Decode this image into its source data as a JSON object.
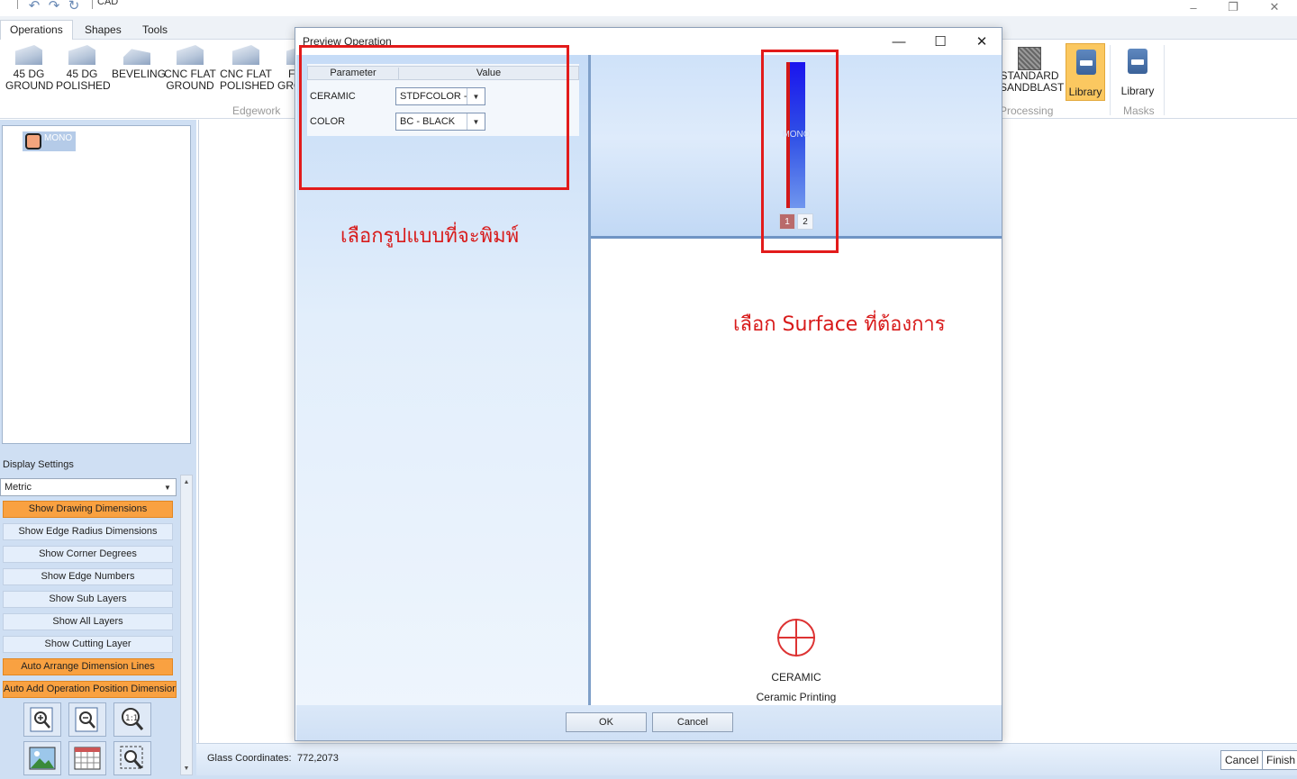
{
  "app": {
    "title": "CAD",
    "window_controls": {
      "minimize": "–",
      "restore": "❐",
      "close": "✕"
    }
  },
  "ribbon": {
    "tabs": [
      "Operations",
      "Shapes",
      "Tools"
    ],
    "edgework": {
      "group_label": "Edgework",
      "items": [
        {
          "line1": "45 DG",
          "line2": "GROUND"
        },
        {
          "line1": "45 DG",
          "line2": "POLISHED"
        },
        {
          "line1": "BEVELING",
          "line2": ""
        },
        {
          "line1": "CNC FLAT",
          "line2": "GROUND"
        },
        {
          "line1": "CNC FLAT",
          "line2": "POLISHED"
        },
        {
          "line1": "FL",
          "line2": "GRO"
        }
      ]
    },
    "processing": {
      "group_label": "Processing",
      "item": {
        "line1": "STANDARD",
        "line2": "SANDBLAST"
      },
      "library_label": "Library"
    },
    "masks": {
      "group_label": "Masks",
      "library_label": "Library"
    }
  },
  "tree": {
    "node_label": "MONO"
  },
  "display_settings": {
    "title": "Display Settings",
    "units": "Metric",
    "buttons": [
      {
        "label": "Show Drawing Dimensions",
        "active": true
      },
      {
        "label": "Show Edge Radius Dimensions",
        "active": false
      },
      {
        "label": "Show Corner Degrees",
        "active": false
      },
      {
        "label": "Show Edge Numbers",
        "active": false
      },
      {
        "label": "Show Sub Layers",
        "active": false
      },
      {
        "label": "Show All Layers",
        "active": false
      },
      {
        "label": "Show Cutting Layer",
        "active": false
      },
      {
        "label": "Auto Arrange Dimension Lines",
        "active": true
      },
      {
        "label": "Auto Add Operation Position Dimension",
        "active": true
      }
    ],
    "tools": [
      "zoom-in-icon",
      "zoom-out-icon",
      "zoom-1to1-icon",
      "image-icon",
      "grid-icon",
      "zoom-selection-icon"
    ]
  },
  "status": {
    "coord_label": "Glass Coordinates:",
    "coord_value": "772,2073",
    "cancel": "Cancel",
    "finish": "Finish"
  },
  "dialog": {
    "title": "Preview Operation",
    "table": {
      "headers": [
        "Parameter",
        "Value"
      ],
      "rows": [
        {
          "param": "CERAMIC",
          "value": "STDFCOLOR -"
        },
        {
          "param": "COLOR",
          "value": "BC - BLACK"
        }
      ]
    },
    "surface": {
      "label": "MONO",
      "tabs": [
        "1",
        "2"
      ],
      "selected": "1"
    },
    "operation": {
      "name": "CERAMIC",
      "subtitle": "Ceramic Printing"
    },
    "buttons": {
      "ok": "OK",
      "cancel": "Cancel"
    }
  },
  "annotations": {
    "left_text": "เลือกรูปแบบที่จะพิมพ์",
    "right_text": "เลือก Surface ที่ต้องการ",
    "color": "#e21b1b"
  }
}
